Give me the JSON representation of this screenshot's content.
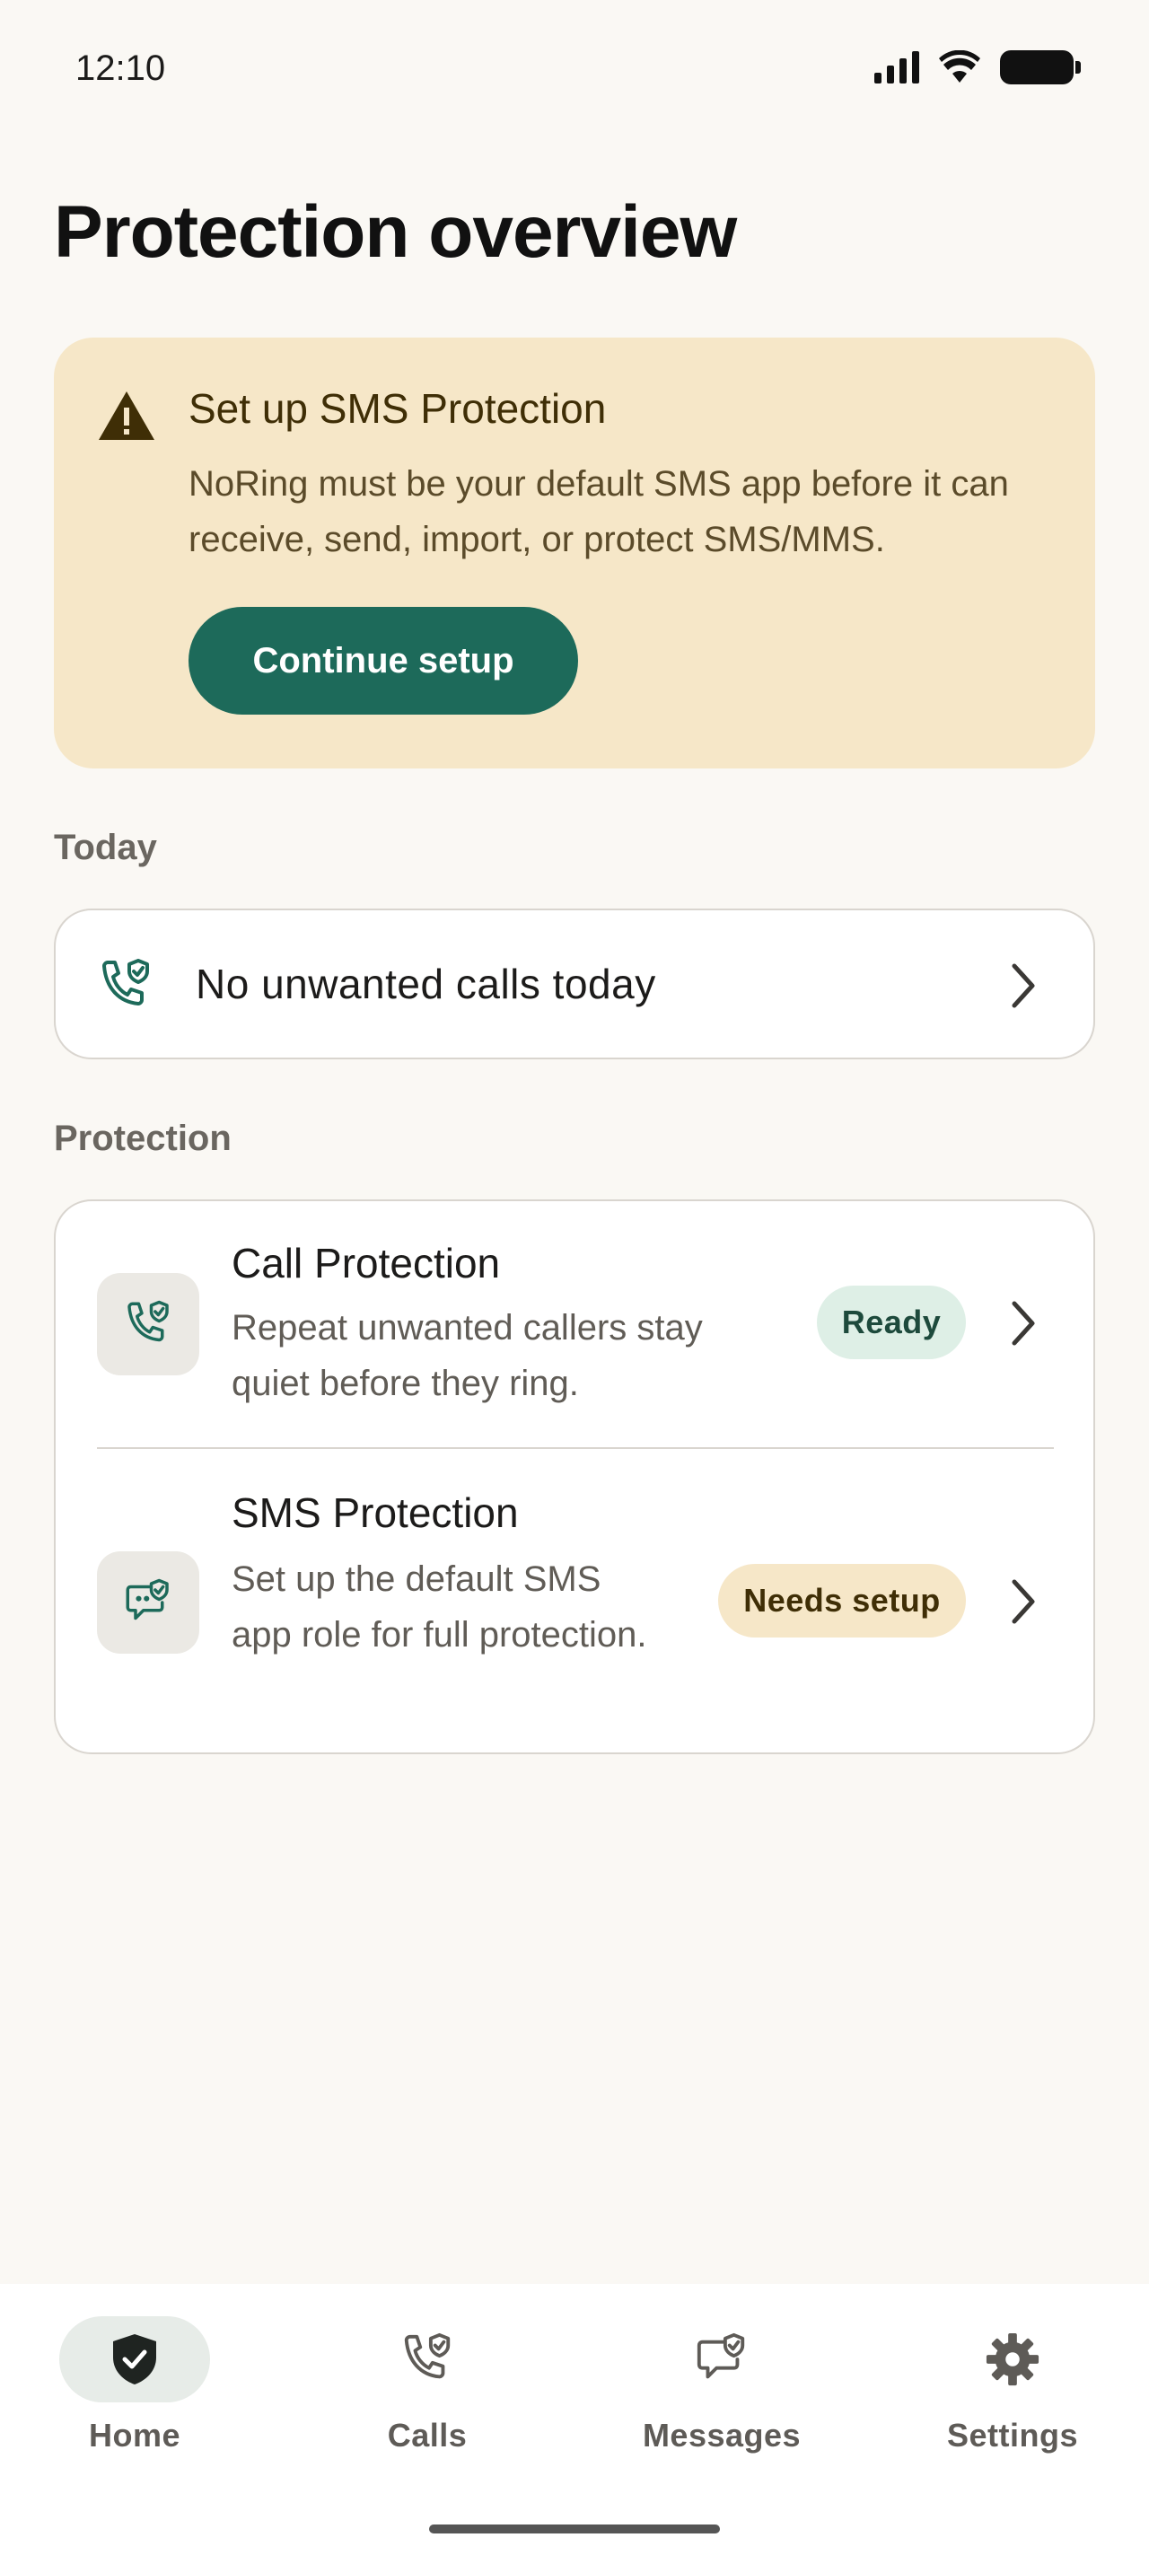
{
  "status_bar": {
    "time": "12:10"
  },
  "page": {
    "title": "Protection overview"
  },
  "banner": {
    "title": "Set up SMS Protection",
    "body": "NoRing must be your default SMS app before it can receive, send, import, or protect SMS/MMS.",
    "button_label": "Continue setup"
  },
  "today": {
    "section_label": "Today",
    "summary": "No unwanted calls today"
  },
  "protection": {
    "section_label": "Protection",
    "rows": [
      {
        "title": "Call Protection",
        "description": "Repeat unwanted callers stay quiet before they ring.",
        "badge": "Ready"
      },
      {
        "title": "SMS Protection",
        "description": "Set up the default SMS app role for full protection.",
        "badge": "Needs setup"
      }
    ]
  },
  "nav": {
    "items": [
      {
        "label": "Home",
        "icon": "shield-check-icon",
        "active": true
      },
      {
        "label": "Calls",
        "icon": "phone-shield-icon",
        "active": false
      },
      {
        "label": "Messages",
        "icon": "message-shield-icon",
        "active": false
      },
      {
        "label": "Settings",
        "icon": "gear-icon",
        "active": false
      }
    ]
  },
  "colors": {
    "accent": "#1d6a5a",
    "banner_bg": "#f6e7c8",
    "ready_badge_bg": "#deefe6",
    "background": "#faf8f4"
  }
}
